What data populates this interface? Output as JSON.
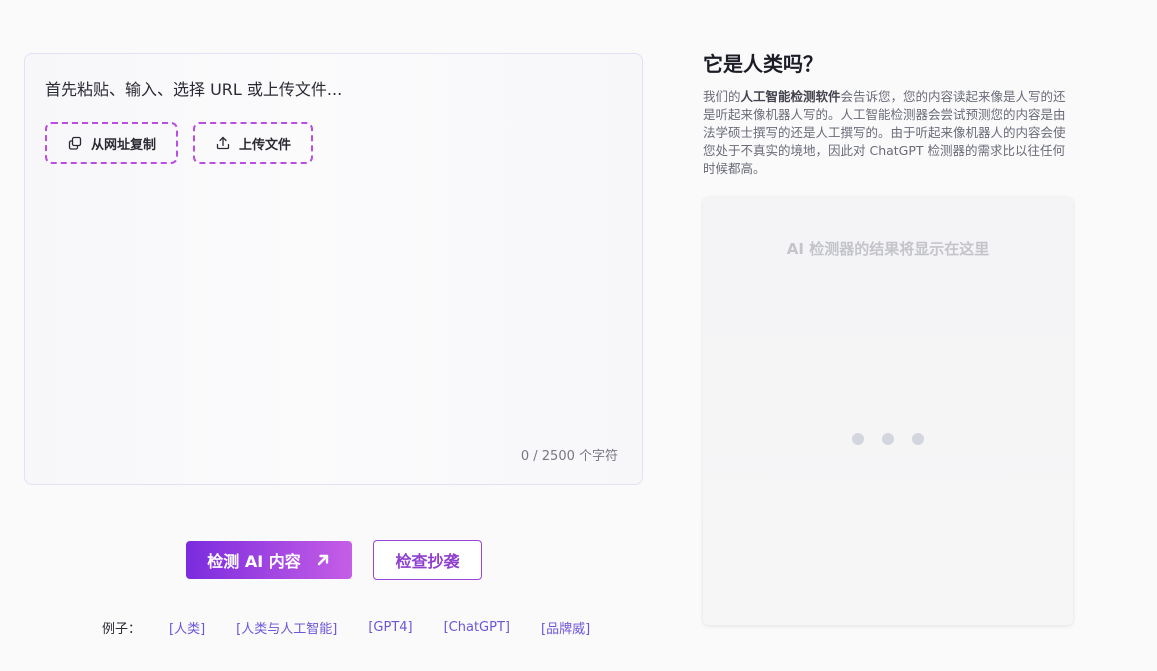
{
  "editor": {
    "placeholder": "首先粘贴、输入、选择 URL 或上传文件...",
    "copy_from_url_label": "从网址复制",
    "upload_file_label": "上传文件",
    "char_count": "0 / 2500 个字符"
  },
  "actions": {
    "detect_label": "检测 AI 内容",
    "plagiarism_label": "检查抄袭"
  },
  "examples": {
    "label": "例子：",
    "items": [
      "[人类]",
      "[人类与人工智能]",
      "[GPT4]",
      "[ChatGPT]",
      "[品牌威]"
    ]
  },
  "info": {
    "title": "它是人类吗？",
    "desc_prefix": "我们的",
    "desc_bold": "人工智能检测软件",
    "desc_rest": "会告诉您，您的内容读起来像是人写的还是听起来像机器人写的。人工智能检测器会尝试预测您的内容是由法学硕士撰写的还是人工撰写的。由于听起来像机器人的内容会使您处于不真实的境地，因此对 ChatGPT 检测器的需求比以往任何时候都高。"
  },
  "result": {
    "placeholder": "AI 检测器的结果将显示在这里"
  },
  "colors": {
    "accent_start": "#7b2bde",
    "accent_end": "#c65ee6",
    "dashed_border": "#b94ee0",
    "link": "#6d55d9"
  },
  "icons": {
    "copy": "copy-icon",
    "upload": "upload-icon",
    "detect_arrow": "arrow-up-right-icon",
    "loading": "loading-dots-icon"
  }
}
